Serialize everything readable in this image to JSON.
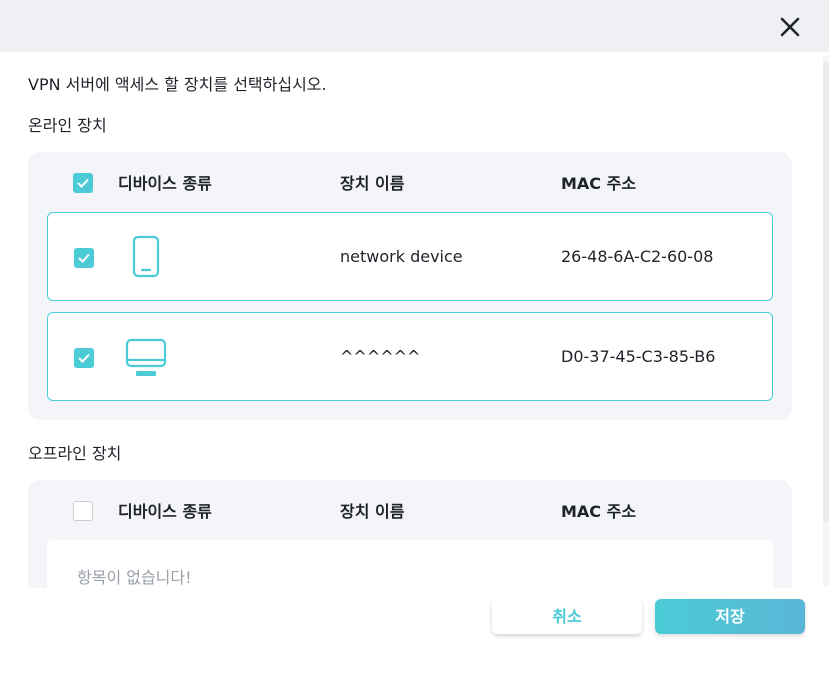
{
  "dialog": {
    "instruction": "VPN 서버에 액세스 할 장치를 선택하십시오.",
    "close_icon": "close-icon"
  },
  "online": {
    "section_label": "온라인 장치",
    "select_all_checked": true,
    "columns": {
      "type": "디바이스 종류",
      "name": "장치 이름",
      "mac": "MAC 주소"
    },
    "devices": [
      {
        "checked": true,
        "icon": "phone-icon",
        "name": "network device",
        "mac": "26-48-6A-C2-60-08"
      },
      {
        "checked": true,
        "icon": "monitor-icon",
        "name": "^^^^^^",
        "mac": "D0-37-45-C3-85-B6"
      }
    ]
  },
  "offline": {
    "section_label": "오프라인 장치",
    "select_all_checked": false,
    "columns": {
      "type": "디바이스 종류",
      "name": "장치 이름",
      "mac": "MAC 주소"
    },
    "empty_text": "항목이 없습니다!"
  },
  "footer": {
    "cancel_label": "취소",
    "save_label": "저장"
  },
  "colors": {
    "accent": "#4acbd6",
    "panel_bg": "#f4f5f9",
    "topbar_bg": "#eef0f3"
  }
}
